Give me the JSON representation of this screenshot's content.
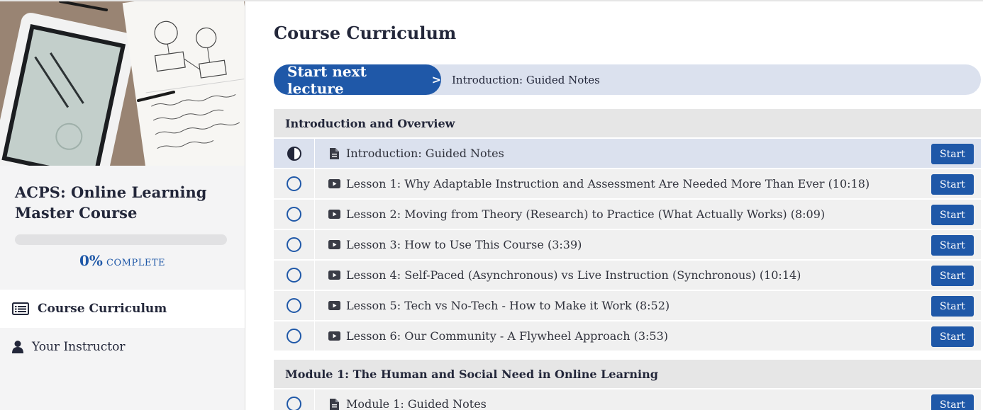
{
  "sidebar": {
    "course_title": "ACPS: Online Learning Master Course",
    "progress": {
      "value_percent": 0,
      "percent_text": "0%",
      "label": "COMPLETE"
    },
    "nav": [
      {
        "label": "Course Curriculum",
        "icon": "list-icon",
        "active": true
      },
      {
        "label": "Your Instructor",
        "icon": "user-icon",
        "active": false
      }
    ]
  },
  "main": {
    "title": "Course Curriculum",
    "next_button": {
      "label": "Start next lecture",
      "chevron": ">"
    },
    "next_lecture": "Introduction: Guided Notes",
    "sections": [
      {
        "title": "Introduction and Overview",
        "lectures": [
          {
            "title": "Introduction: Guided Notes",
            "type": "document-icon",
            "status": "in-progress",
            "button": "Start"
          },
          {
            "title": "Lesson 1: Why Adaptable Instruction and Assessment Are Needed More Than Ever (10:18)",
            "type": "video-icon",
            "status": "not-started",
            "button": "Start"
          },
          {
            "title": "Lesson 2: Moving from Theory (Research) to Practice (What Actually Works) (8:09)",
            "type": "video-icon",
            "status": "not-started",
            "button": "Start"
          },
          {
            "title": "Lesson 3: How to Use This Course (3:39)",
            "type": "video-icon",
            "status": "not-started",
            "button": "Start"
          },
          {
            "title": "Lesson 4: Self-Paced (Asynchronous) vs Live Instruction (Synchronous) (10:14)",
            "type": "video-icon",
            "status": "not-started",
            "button": "Start"
          },
          {
            "title": "Lesson 5: Tech vs No-Tech - How to Make it Work (8:52)",
            "type": "video-icon",
            "status": "not-started",
            "button": "Start"
          },
          {
            "title": "Lesson 6: Our Community - A Flywheel Approach (3:53)",
            "type": "video-icon",
            "status": "not-started",
            "button": "Start"
          }
        ]
      },
      {
        "title": "Module 1: The Human and Social Need in Online Learning",
        "lectures": [
          {
            "title": "Module 1: Guided Notes",
            "type": "document-icon",
            "status": "not-started",
            "button": "Start"
          }
        ]
      }
    ]
  },
  "colors": {
    "accent": "#1f58a8",
    "current_row": "#dbe1ee",
    "row": "#f0f0f0",
    "section_header": "#e6e6e6",
    "sidebar_bg": "#f4f4f5"
  }
}
